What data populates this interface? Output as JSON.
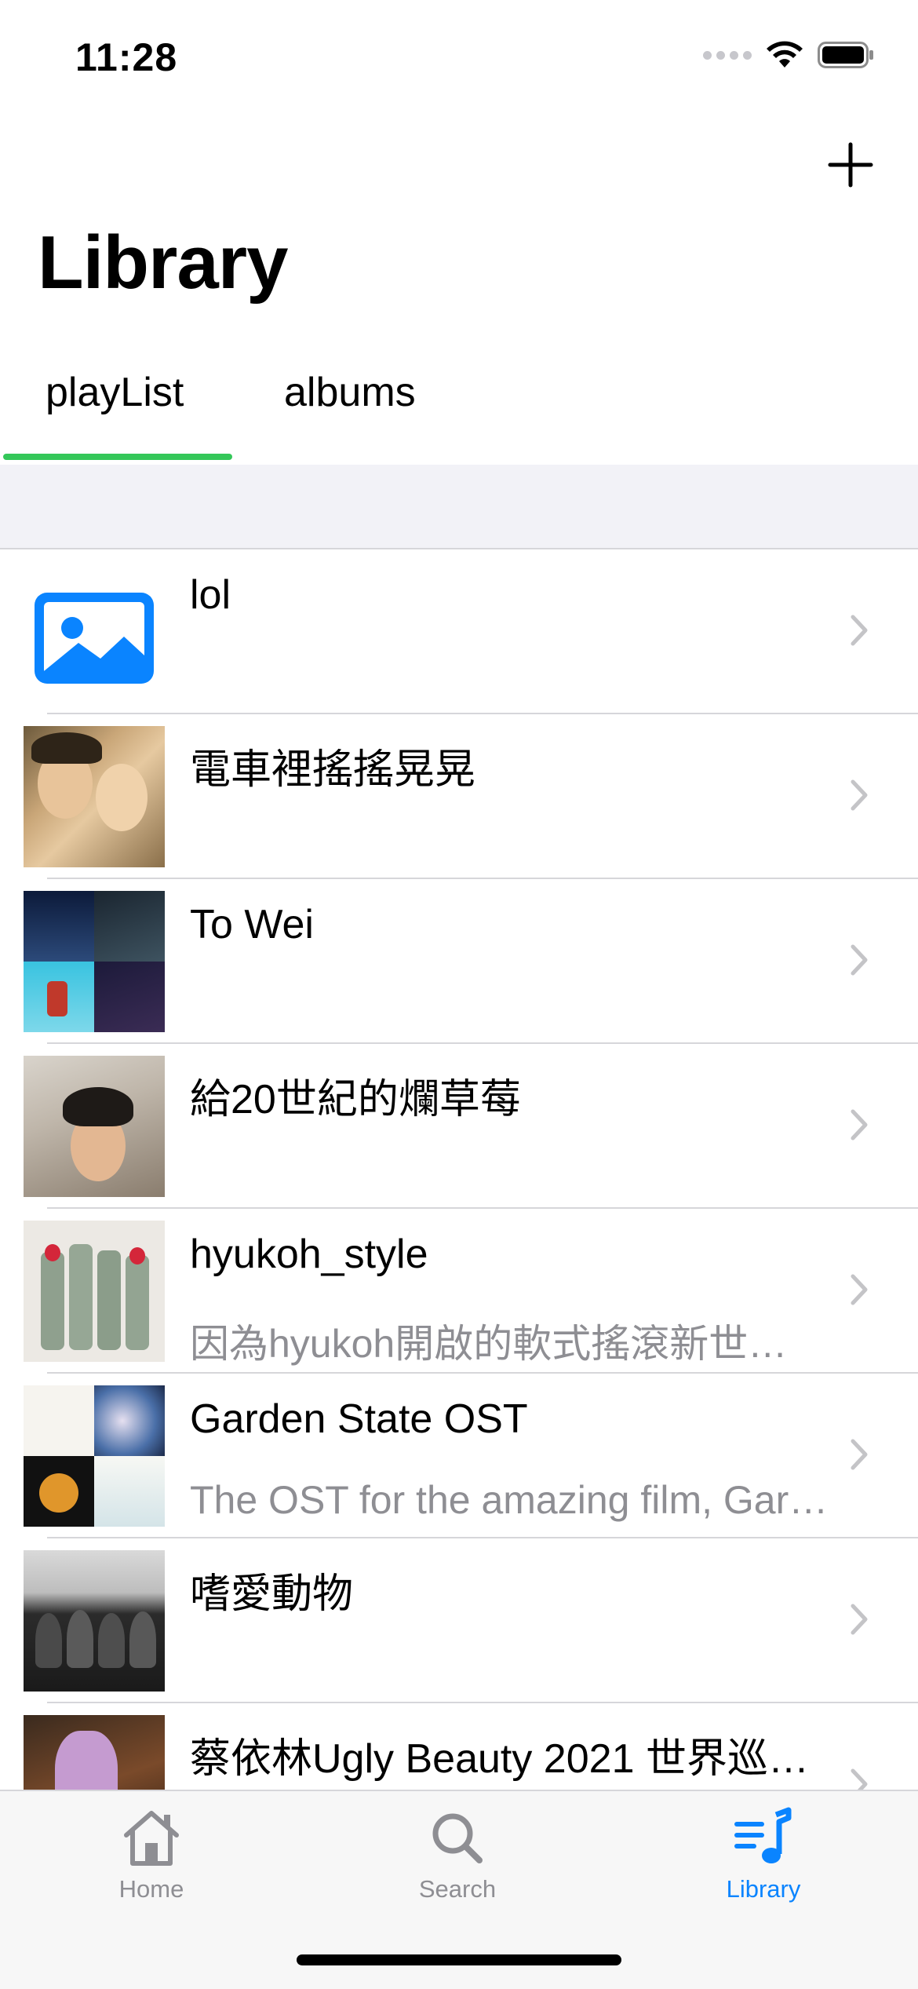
{
  "status_bar": {
    "time": "11:28"
  },
  "header": {
    "title": "Library",
    "add_icon": "plus-icon"
  },
  "tabs": [
    {
      "label": "playList",
      "selected": true
    },
    {
      "label": "albums",
      "selected": false
    }
  ],
  "accent_color": "#34c759",
  "tab_bar_active_color": "#0a84ff",
  "playlists": [
    {
      "title": "lol",
      "subtitle": "",
      "thumb": "placeholder-photo-icon"
    },
    {
      "title": "電車裡搖搖晃晃",
      "subtitle": "",
      "thumb": "cover-photo"
    },
    {
      "title": "To Wei",
      "subtitle": "",
      "thumb": "cover-collage"
    },
    {
      "title": "給20世紀的爛草莓",
      "subtitle": "",
      "thumb": "cover-photo"
    },
    {
      "title": "hyukoh_style",
      "subtitle": "因為hyukoh開啟的軟式搖滾新世…",
      "thumb": "cover-photo"
    },
    {
      "title": "Garden State OST",
      "subtitle": "The OST for the amazing film, Gar…",
      "thumb": "cover-collage"
    },
    {
      "title": "嗜愛動物",
      "subtitle": "",
      "thumb": "cover-photo"
    },
    {
      "title": "蔡依林Ugly Beauty 2021 世界巡…",
      "subtitle": "",
      "thumb": "cover-photo"
    }
  ],
  "tab_bar": [
    {
      "label": "Home",
      "icon": "house-icon",
      "active": false
    },
    {
      "label": "Search",
      "icon": "magnifier-icon",
      "active": false
    },
    {
      "label": "Library",
      "icon": "music-list-icon",
      "active": true
    }
  ]
}
